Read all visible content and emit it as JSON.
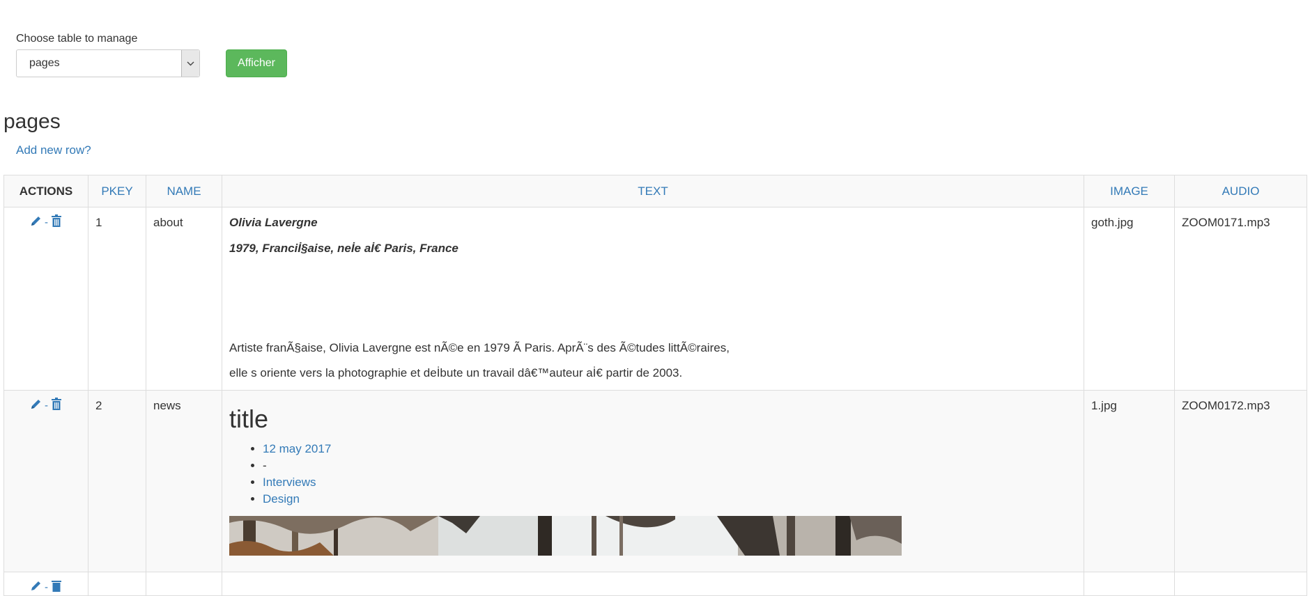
{
  "chooser": {
    "label": "Choose table to manage",
    "selected": "pages",
    "button_label": "Afficher"
  },
  "heading": "pages",
  "add_row_link": "Add new row?",
  "table": {
    "columns": [
      "ACTIONS",
      "PKEY",
      "NAME",
      "TEXT",
      "IMAGE",
      "AUDIO"
    ],
    "action_separator": "-",
    "rows": [
      {
        "pkey": "1",
        "name": "about",
        "text_title": "Olivia Lavergne",
        "text_subtitle": "1979, Franciİ§aise, neİe aİ€ Paris, France",
        "text_line1": "Artiste franÃ§aise, Olivia Lavergne est nÃ©e en 1979 Ã Paris. AprÃ¨s des Ã©tudes littÃ©raires,",
        "text_line2": "elle s oriente vers la photographie et deİbute un travail dâ€™auteur aİ€ partir de 2003.",
        "image": "goth.jpg",
        "audio": "ZOOM0171.mp3"
      },
      {
        "pkey": "2",
        "name": "news",
        "text_title": "title",
        "meta": [
          "12 may 2017",
          "-",
          "Interviews",
          "Design"
        ],
        "image": "1.jpg",
        "audio": "ZOOM0172.mp3"
      }
    ]
  },
  "colors": {
    "link": "#337ab7",
    "button": "#5cb85c",
    "header_bg": "#f9f9f9",
    "border": "#dddddd"
  },
  "icons": {
    "edit": "pencil-icon",
    "delete": "trash-icon",
    "dropdown": "chevron-down-icon"
  }
}
